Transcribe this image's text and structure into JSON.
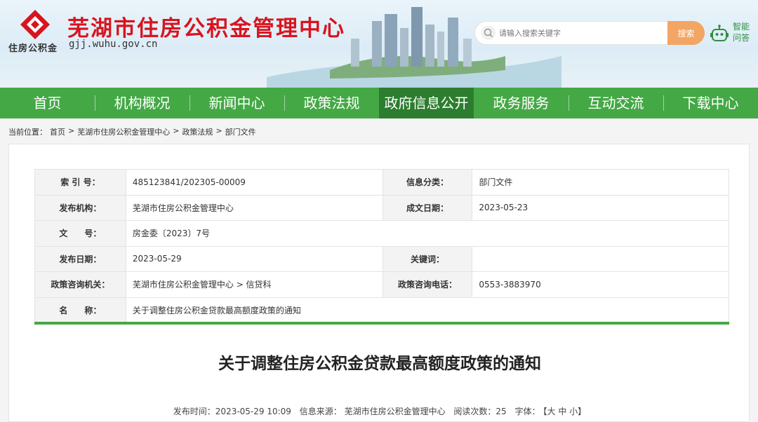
{
  "header": {
    "logo_sub": "住房公积金",
    "title": "芜湖市住房公积金管理中心",
    "url": "gjj.wuhu.gov.cn",
    "search_placeholder": "请输入搜索关键字",
    "search_label": "搜索",
    "ai_label": "智能问答"
  },
  "nav": [
    {
      "label": "首页"
    },
    {
      "label": "机构概况"
    },
    {
      "label": "新闻中心"
    },
    {
      "label": "政策法规"
    },
    {
      "label": "政府信息公开"
    },
    {
      "label": "政务服务"
    },
    {
      "label": "互动交流"
    },
    {
      "label": "下载中心"
    }
  ],
  "breadcrumb": {
    "prefix": "当前位置：",
    "items": [
      "首页",
      ">",
      "芜湖市住房公积金管理中心",
      ">",
      "政策法规",
      ">",
      "部门文件"
    ]
  },
  "meta": {
    "index_key": "索 引 号：",
    "index_val": "485123841/202305-00009",
    "category_key": "信息分类：",
    "category_val": "部门文件",
    "publisher_key": "发布机构：",
    "publisher_val": "芜湖市住房公积金管理中心",
    "created_key": "成文日期：",
    "created_val": "2023-05-23",
    "docno_key": "文　　号：",
    "docno_val": "房金委〔2023〕7号",
    "pubdate_key": "发布日期：",
    "pubdate_val": "2023-05-29",
    "keywords_key": "关键词：",
    "keywords_val": "",
    "consult_org_key": "政策咨询机关：",
    "consult_org_val": "芜湖市住房公积金管理中心 > 信贷科",
    "consult_tel_key": "政策咨询电话：",
    "consult_tel_val": "0553-3883970",
    "name_key": "名　　称：",
    "name_val": "关于调整住房公积金贷款最高额度政策的通知"
  },
  "document": {
    "title": "关于调整住房公积金贷款最高额度政策的通知",
    "time": "发布时间：2023-05-29 10:09",
    "source": "信息来源： 芜湖市住房公积金管理中心",
    "views": "阅读次数：25",
    "font_label": "字体：",
    "font_sizes": "【大 中 小】"
  },
  "colors": {
    "brand_red": "#d8141f",
    "nav_green": "#44a845",
    "nav_active": "#2c7d2f",
    "search_orange": "#f3a563"
  }
}
